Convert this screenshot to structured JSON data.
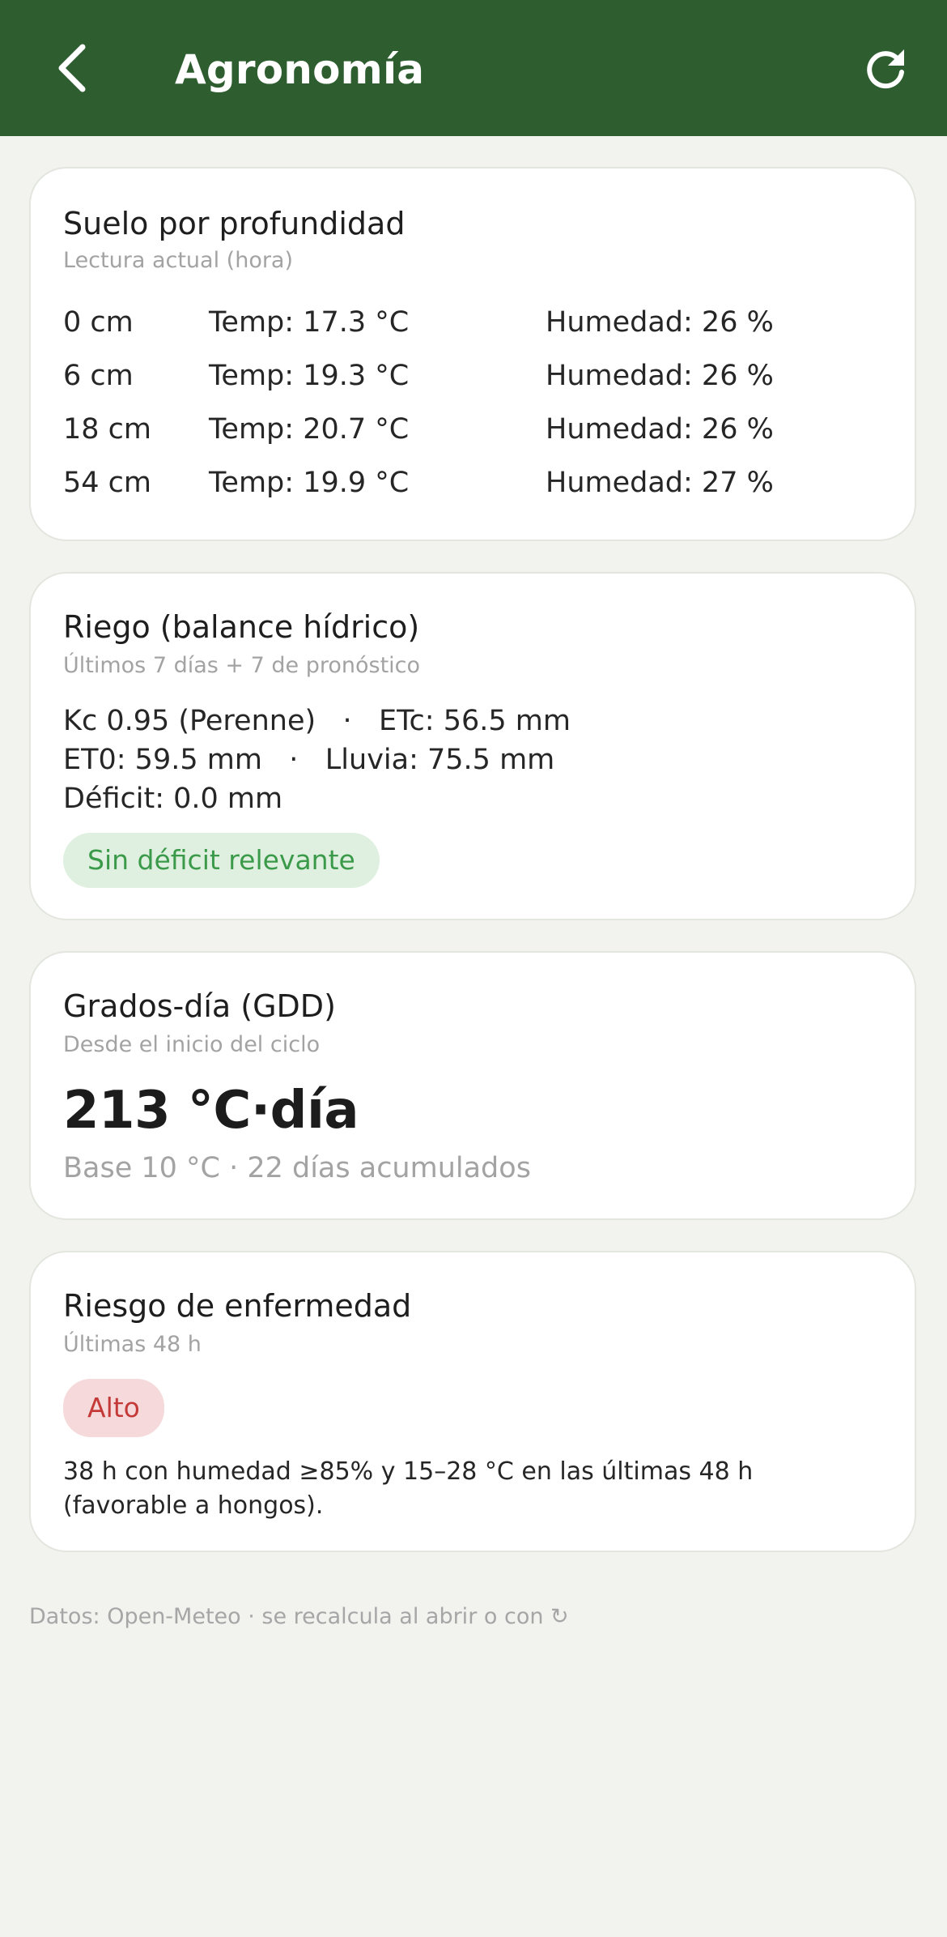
{
  "header": {
    "title": "Agronomía",
    "back_icon": "chevron-left-icon",
    "refresh_icon": "refresh-icon",
    "bg_color": "#2e5e30"
  },
  "soil": {
    "title": "Suelo por profundidad",
    "subtitle": "Lectura actual (hora)",
    "rows": [
      {
        "depth": "0 cm",
        "temp": "Temp: 17.3 °C",
        "humidity": "Humedad: 26 %"
      },
      {
        "depth": "6 cm",
        "temp": "Temp: 19.3 °C",
        "humidity": "Humedad: 26 %"
      },
      {
        "depth": "18 cm",
        "temp": "Temp: 20.7 °C",
        "humidity": "Humedad: 26 %"
      },
      {
        "depth": "54 cm",
        "temp": "Temp: 19.9 °C",
        "humidity": "Humedad: 27 %"
      }
    ]
  },
  "irrigation": {
    "title": "Riego (balance hídrico)",
    "subtitle": "Últimos 7 días + 7 de pronóstico",
    "line1": "Kc 0.95 (Perenne)   ·   ETc: 56.5 mm",
    "line2": "ET0: 59.5 mm   ·   Lluvia: 75.5 mm",
    "line3": "Déficit: 0.0 mm",
    "status": "Sin déficit relevante",
    "status_color": "#3b9a49"
  },
  "gdd": {
    "title": "Grados-día (GDD)",
    "subtitle": "Desde el inicio del ciclo",
    "value": "213 °C·día",
    "detail": "Base 10 °C · 22 días acumulados"
  },
  "disease": {
    "title": "Riesgo de enfermedad",
    "subtitle": "Últimas 48 h",
    "level": "Alto",
    "level_color": "#c43a39",
    "description": "38 h con humedad ≥85% y 15–28 °C en las últimas 48 h (favorable a hongos)."
  },
  "footer": {
    "text": "Datos: Open-Meteo · se recalcula al abrir o con ↻"
  }
}
